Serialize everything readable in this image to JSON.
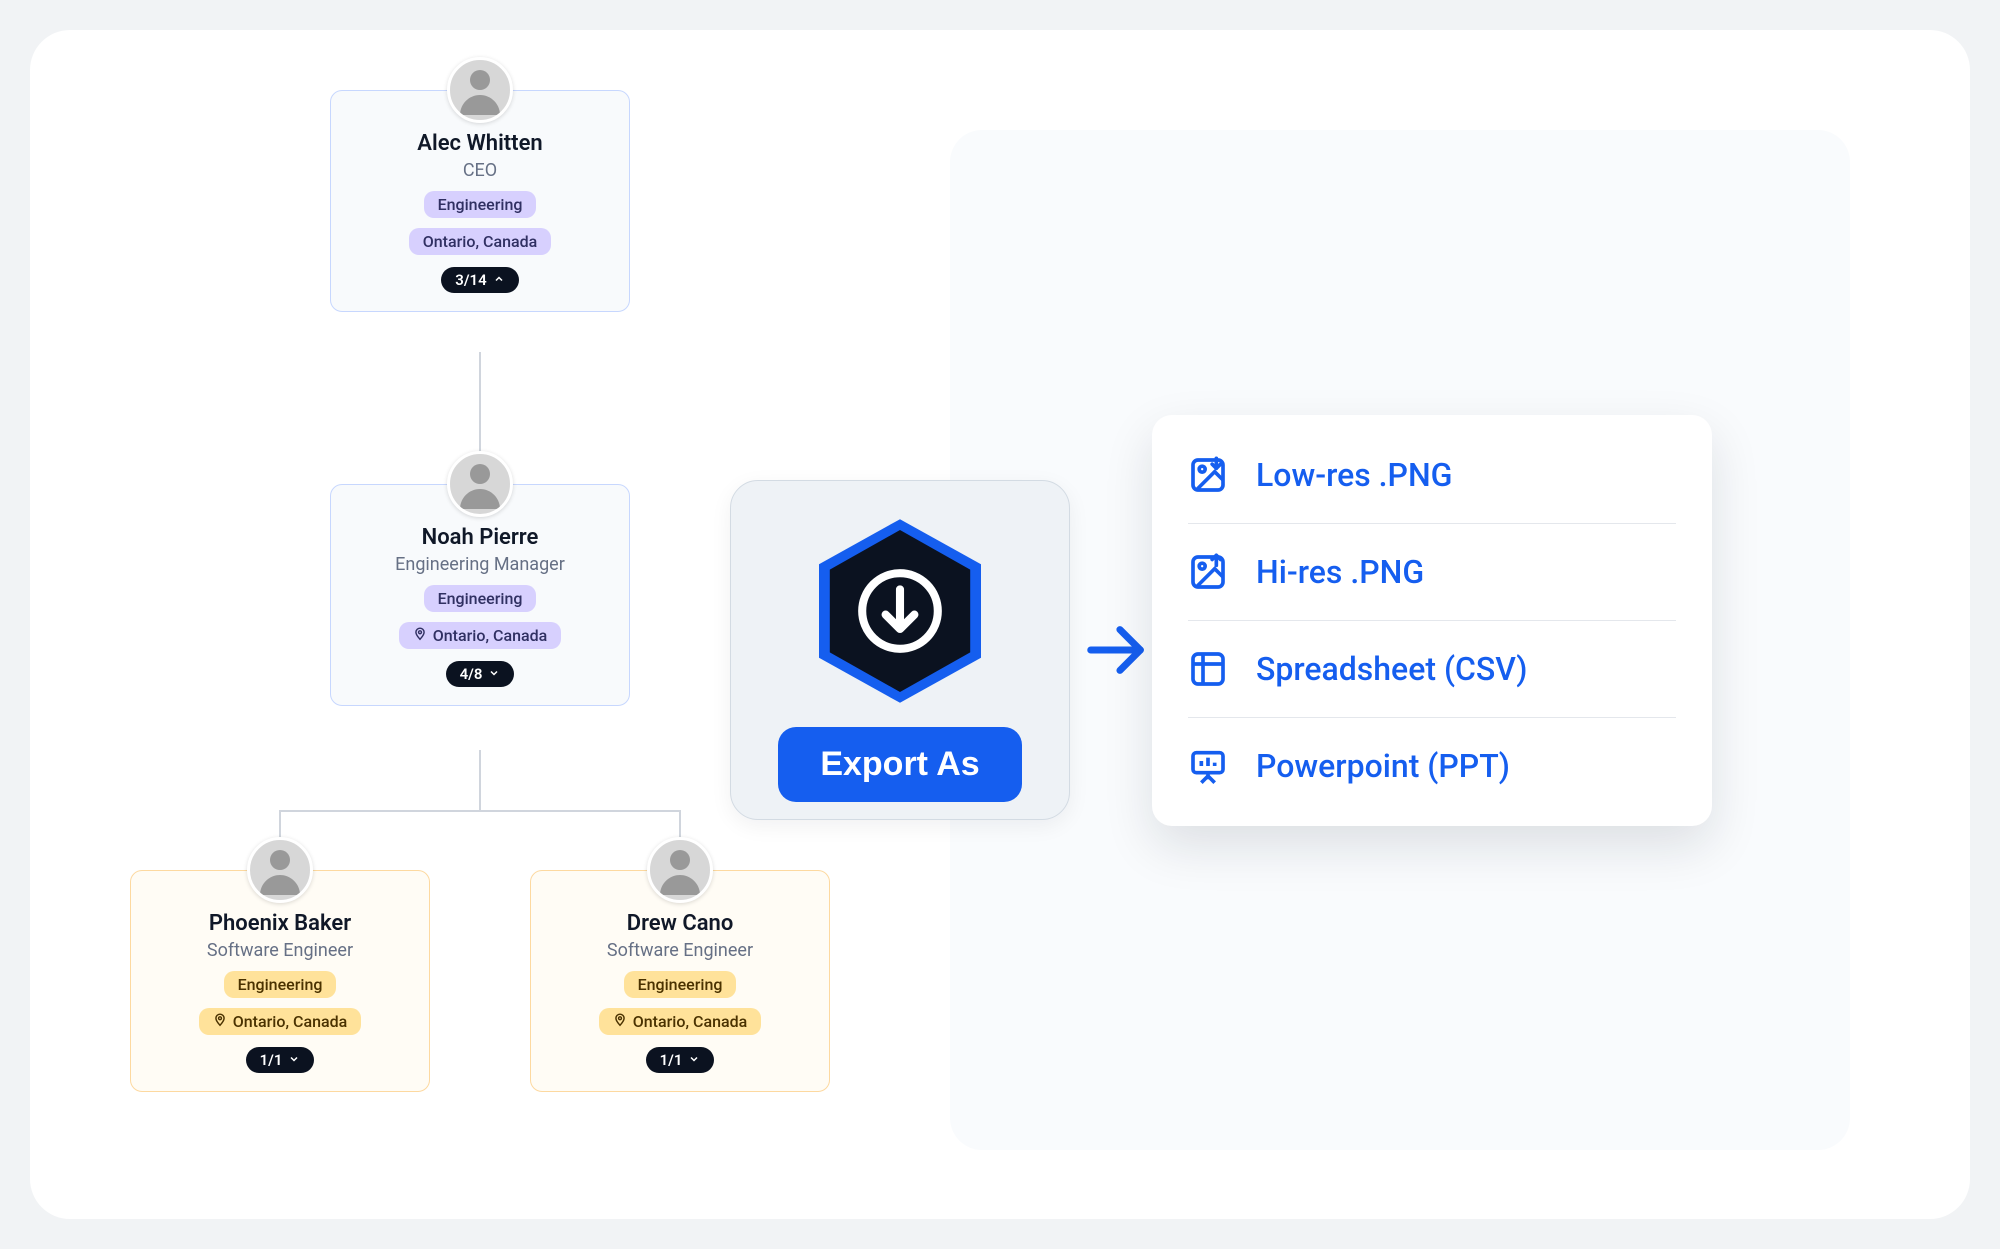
{
  "org": {
    "nodes": [
      {
        "id": "alec",
        "name": "Alec Whitten",
        "title": "CEO",
        "dept": "Engineering",
        "location": "Ontario, Canada",
        "count": "3/14",
        "expanded": true,
        "color": "purple",
        "location_has_pin": false
      },
      {
        "id": "noah",
        "name": "Noah Pierre",
        "title": "Engineering Manager",
        "dept": "Engineering",
        "location": "Ontario, Canada",
        "count": "4/8",
        "expanded": false,
        "color": "purple",
        "location_has_pin": true
      },
      {
        "id": "phoenix",
        "name": "Phoenix Baker",
        "title": "Software Engineer",
        "dept": "Engineering",
        "location": "Ontario, Canada",
        "count": "1/1",
        "expanded": false,
        "color": "yellow",
        "location_has_pin": true
      },
      {
        "id": "drew",
        "name": "Drew Cano",
        "title": "Software Engineer",
        "dept": "Engineering",
        "location": "Ontario, Canada",
        "count": "1/1",
        "expanded": false,
        "color": "yellow",
        "location_has_pin": true
      }
    ]
  },
  "export": {
    "button_label": "Export As",
    "options": [
      {
        "icon": "image-down",
        "label": "Low-res .PNG"
      },
      {
        "icon": "image-up",
        "label": "Hi-res .PNG"
      },
      {
        "icon": "table",
        "label": "Spreadsheet (CSV)"
      },
      {
        "icon": "presentation",
        "label": "Powerpoint (PPT)"
      }
    ]
  }
}
